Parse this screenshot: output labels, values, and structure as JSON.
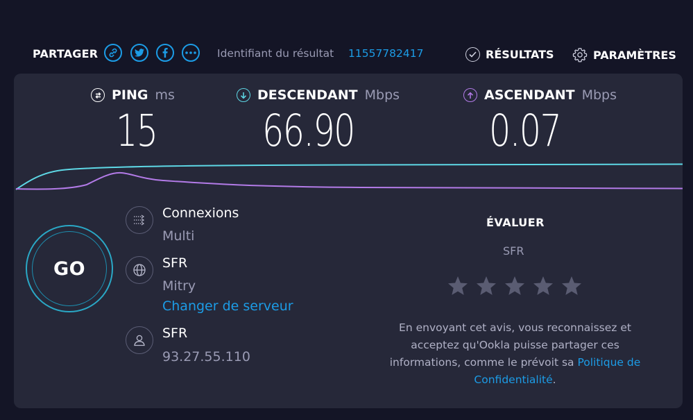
{
  "header": {
    "share_label": "PARTAGER",
    "share_buttons": [
      {
        "icon": "link-icon"
      },
      {
        "icon": "twitter-icon"
      },
      {
        "icon": "facebook-icon"
      },
      {
        "icon": "more-icon"
      }
    ],
    "result_id_label": "Identifiant du résultat",
    "result_id_value": "11557782417",
    "results_label": "RÉSULTATS",
    "results_icon": "check-circle-icon",
    "settings_label": "PARAMÈTRES",
    "settings_icon": "gear-icon"
  },
  "metrics": {
    "ping": {
      "label": "PING",
      "unit": "ms",
      "value": "15",
      "icon": "ping-icon"
    },
    "download": {
      "label": "DESCENDANT",
      "unit": "Mbps",
      "value": "66.90",
      "icon": "download-arrow-icon",
      "color": "#5ed8e6"
    },
    "upload": {
      "label": "ASCENDANT",
      "unit": "Mbps",
      "value": "0.07",
      "icon": "upload-arrow-icon",
      "color": "#b37be8"
    }
  },
  "go_label": "GO",
  "info": {
    "connections": {
      "title": "Connexions",
      "value": "Multi",
      "icon": "connections-icon"
    },
    "server": {
      "title": "SFR",
      "location": "Mitry",
      "change_label": "Changer de serveur",
      "icon": "globe-icon"
    },
    "provider": {
      "title": "SFR",
      "ip": "93.27.55.110",
      "icon": "user-icon"
    }
  },
  "rating": {
    "title": "ÉVALUER",
    "isp": "SFR",
    "stars": 5,
    "rating_value": 0,
    "disclaimer_text": "En envoyant cet avis, vous reconnaissez et acceptez qu'Ookla puisse partager ces informations, comme le prévoit sa ",
    "disclaimer_link": "Politique de Confidentialité",
    "disclaimer_end": "."
  },
  "colors": {
    "accent": "#1c9ce6",
    "background": "#141526",
    "panel": "#262839",
    "download_line": "#5ed8e6",
    "upload_line": "#b37be8",
    "star_empty": "#5a5c72"
  }
}
